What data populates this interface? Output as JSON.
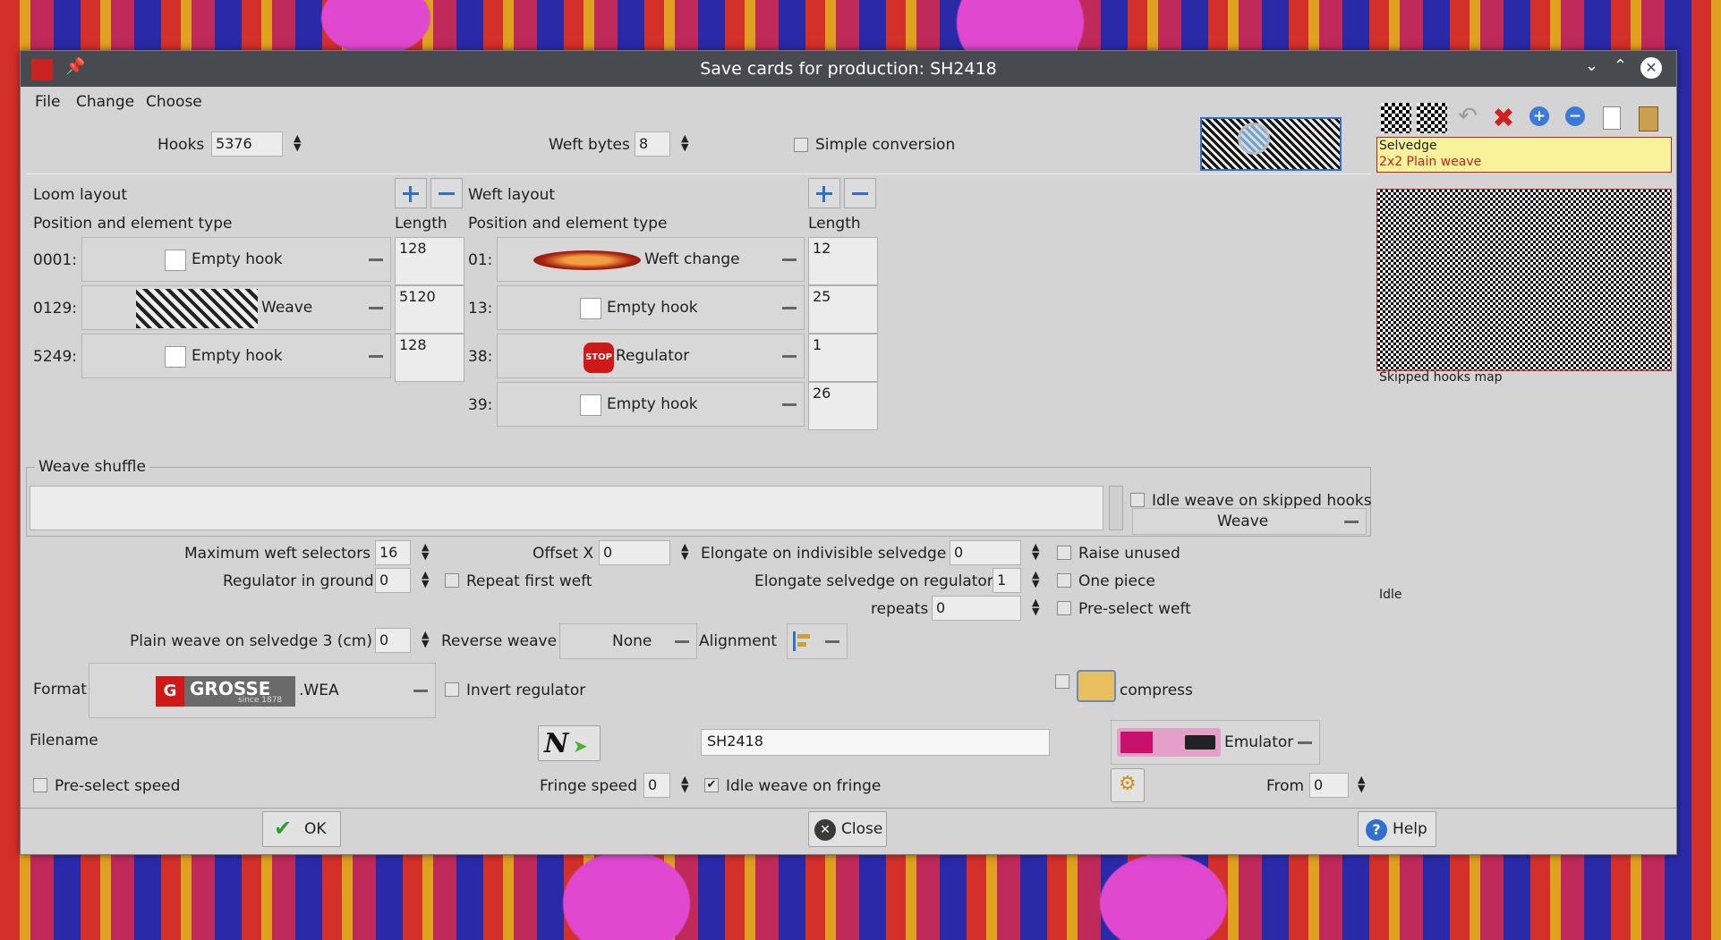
{
  "window": {
    "title": "Save cards for production: SH2418"
  },
  "menu": {
    "file": "File",
    "change": "Change",
    "choose": "Choose"
  },
  "top": {
    "hooks_label": "Hooks",
    "hooks_value": "5376",
    "weft_bytes_label": "Weft bytes",
    "weft_bytes_value": "8",
    "simple_conversion_label": "Simple conversion"
  },
  "loom": {
    "title": "Loom layout",
    "col_position": "Position and element type",
    "col_length": "Length",
    "rows": [
      {
        "pos": "0001:",
        "type": "Empty hook",
        "length": "128"
      },
      {
        "pos": "0129:",
        "type": "Weave",
        "length": "5120"
      },
      {
        "pos": "5249:",
        "type": "Empty hook",
        "length": "128"
      }
    ]
  },
  "weft": {
    "title": "Weft layout",
    "col_position": "Position and element type",
    "col_length": "Length",
    "rows": [
      {
        "pos": "01:",
        "type": "Weft change",
        "length": "12"
      },
      {
        "pos": "13:",
        "type": "Empty hook",
        "length": "25"
      },
      {
        "pos": "38:",
        "type": "Regulator",
        "length": "1"
      },
      {
        "pos": "39:",
        "type": "Empty hook",
        "length": "26"
      }
    ]
  },
  "side": {
    "selvedge_label": "Selvedge",
    "selvedge_item": "2x2 Plain weave",
    "skipped_map_label": "Skipped hooks map",
    "idle_label": "Idle"
  },
  "shuffle": {
    "title": "Weave shuffle",
    "value": "",
    "idle_weave_skipped_label": "Idle weave on skipped hooks",
    "weave_combo": "Weave"
  },
  "params": {
    "max_weft_selectors_label": "Maximum weft selectors",
    "max_weft_selectors": "16",
    "offset_x_label": "Offset X",
    "offset_x": "0",
    "elongate_indivisible_label": "Elongate on indivisible selvedge",
    "elongate_indivisible": "0",
    "raise_unused_label": "Raise unused",
    "regulator_ground_label": "Regulator in ground",
    "regulator_ground": "0",
    "repeat_first_weft_label": "Repeat first weft",
    "elongate_regulator_label": "Elongate selvedge on regulator",
    "elongate_regulator": "1",
    "one_piece_label": "One piece",
    "repeats_label": "repeats",
    "repeats": "0",
    "preselect_weft_label": "Pre-select weft",
    "plain_weave_label": "Plain weave on selvedge 3 (cm)",
    "plain_weave": "0",
    "reverse_weave_label": "Reverse weave",
    "reverse_weave": "None",
    "alignment_label": "Alignment"
  },
  "format": {
    "label": "Format",
    "brand": "GROSSE",
    "brand_sub": "since 1878",
    "ext": ".WEA",
    "invert_regulator_label": "Invert regulator",
    "compress_label": "compress"
  },
  "filename": {
    "label": "Filename",
    "value": "SH2418",
    "emulator": "Emulator"
  },
  "bottom_row": {
    "preselect_speed_label": "Pre-select speed",
    "fringe_speed_label": "Fringe speed",
    "fringe_speed": "0",
    "idle_fringe_label": "Idle weave on fringe",
    "from_label": "From",
    "from_value": "0"
  },
  "buttons": {
    "ok": "OK",
    "close": "Close",
    "help": "Help"
  },
  "colors": {
    "accent": "#2f6fd0",
    "titlebar": "#474a4f",
    "selvedge_bg": "#f8f39a",
    "selvedge_item": "#c82020"
  }
}
